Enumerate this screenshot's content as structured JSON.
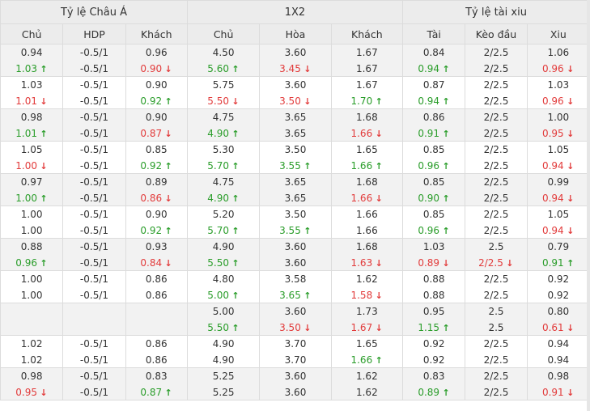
{
  "headers": {
    "groups": [
      "Tỷ lệ Châu Á",
      "1X2",
      "Tỷ lệ tài xiu"
    ],
    "columns": [
      "Chủ",
      "HDP",
      "Khách",
      "Chủ",
      "Hòa",
      "Khách",
      "Tài",
      "Kèo đầu",
      "Xiu"
    ]
  },
  "colors": {
    "up": "#2a9d2a",
    "down": "#e23b3b",
    "header_bg": "#ececec",
    "stripe_bg": "#f2f2f2"
  },
  "icons": {
    "up": "arrow-up-icon",
    "down": "arrow-down-icon"
  },
  "rows": [
    [
      [
        {
          "v": "0.94",
          "d": "same"
        },
        {
          "v": "1.03",
          "d": "up"
        }
      ],
      [
        {
          "v": "-0.5/1",
          "d": "same"
        },
        {
          "v": "-0.5/1",
          "d": "same"
        }
      ],
      [
        {
          "v": "0.96",
          "d": "same"
        },
        {
          "v": "0.90",
          "d": "down"
        }
      ],
      [
        {
          "v": "4.50",
          "d": "same"
        },
        {
          "v": "5.60",
          "d": "up"
        }
      ],
      [
        {
          "v": "3.60",
          "d": "same"
        },
        {
          "v": "3.45",
          "d": "down"
        }
      ],
      [
        {
          "v": "1.67",
          "d": "same"
        },
        {
          "v": "1.67",
          "d": "same"
        }
      ],
      [
        {
          "v": "0.84",
          "d": "same"
        },
        {
          "v": "0.94",
          "d": "up"
        }
      ],
      [
        {
          "v": "2/2.5",
          "d": "same"
        },
        {
          "v": "2/2.5",
          "d": "same"
        }
      ],
      [
        {
          "v": "1.06",
          "d": "same"
        },
        {
          "v": "0.96",
          "d": "down"
        }
      ]
    ],
    [
      [
        {
          "v": "1.03",
          "d": "same"
        },
        {
          "v": "1.01",
          "d": "down"
        }
      ],
      [
        {
          "v": "-0.5/1",
          "d": "same"
        },
        {
          "v": "-0.5/1",
          "d": "same"
        }
      ],
      [
        {
          "v": "0.90",
          "d": "same"
        },
        {
          "v": "0.92",
          "d": "up"
        }
      ],
      [
        {
          "v": "5.75",
          "d": "same"
        },
        {
          "v": "5.50",
          "d": "down"
        }
      ],
      [
        {
          "v": "3.60",
          "d": "same"
        },
        {
          "v": "3.50",
          "d": "down"
        }
      ],
      [
        {
          "v": "1.67",
          "d": "same"
        },
        {
          "v": "1.70",
          "d": "up"
        }
      ],
      [
        {
          "v": "0.87",
          "d": "same"
        },
        {
          "v": "0.94",
          "d": "up"
        }
      ],
      [
        {
          "v": "2/2.5",
          "d": "same"
        },
        {
          "v": "2/2.5",
          "d": "same"
        }
      ],
      [
        {
          "v": "1.03",
          "d": "same"
        },
        {
          "v": "0.96",
          "d": "down"
        }
      ]
    ],
    [
      [
        {
          "v": "0.98",
          "d": "same"
        },
        {
          "v": "1.01",
          "d": "up"
        }
      ],
      [
        {
          "v": "-0.5/1",
          "d": "same"
        },
        {
          "v": "-0.5/1",
          "d": "same"
        }
      ],
      [
        {
          "v": "0.90",
          "d": "same"
        },
        {
          "v": "0.87",
          "d": "down"
        }
      ],
      [
        {
          "v": "4.75",
          "d": "same"
        },
        {
          "v": "4.90",
          "d": "up"
        }
      ],
      [
        {
          "v": "3.65",
          "d": "same"
        },
        {
          "v": "3.65",
          "d": "same"
        }
      ],
      [
        {
          "v": "1.68",
          "d": "same"
        },
        {
          "v": "1.66",
          "d": "down"
        }
      ],
      [
        {
          "v": "0.86",
          "d": "same"
        },
        {
          "v": "0.91",
          "d": "up"
        }
      ],
      [
        {
          "v": "2/2.5",
          "d": "same"
        },
        {
          "v": "2/2.5",
          "d": "same"
        }
      ],
      [
        {
          "v": "1.00",
          "d": "same"
        },
        {
          "v": "0.95",
          "d": "down"
        }
      ]
    ],
    [
      [
        {
          "v": "1.05",
          "d": "same"
        },
        {
          "v": "1.00",
          "d": "down"
        }
      ],
      [
        {
          "v": "-0.5/1",
          "d": "same"
        },
        {
          "v": "-0.5/1",
          "d": "same"
        }
      ],
      [
        {
          "v": "0.85",
          "d": "same"
        },
        {
          "v": "0.92",
          "d": "up"
        }
      ],
      [
        {
          "v": "5.30",
          "d": "same"
        },
        {
          "v": "5.70",
          "d": "up"
        }
      ],
      [
        {
          "v": "3.50",
          "d": "same"
        },
        {
          "v": "3.55",
          "d": "up"
        }
      ],
      [
        {
          "v": "1.65",
          "d": "same"
        },
        {
          "v": "1.66",
          "d": "up"
        }
      ],
      [
        {
          "v": "0.85",
          "d": "same"
        },
        {
          "v": "0.96",
          "d": "up"
        }
      ],
      [
        {
          "v": "2/2.5",
          "d": "same"
        },
        {
          "v": "2/2.5",
          "d": "same"
        }
      ],
      [
        {
          "v": "1.05",
          "d": "same"
        },
        {
          "v": "0.94",
          "d": "down"
        }
      ]
    ],
    [
      [
        {
          "v": "0.97",
          "d": "same"
        },
        {
          "v": "1.00",
          "d": "up"
        }
      ],
      [
        {
          "v": "-0.5/1",
          "d": "same"
        },
        {
          "v": "-0.5/1",
          "d": "same"
        }
      ],
      [
        {
          "v": "0.89",
          "d": "same"
        },
        {
          "v": "0.86",
          "d": "down"
        }
      ],
      [
        {
          "v": "4.75",
          "d": "same"
        },
        {
          "v": "4.90",
          "d": "up"
        }
      ],
      [
        {
          "v": "3.65",
          "d": "same"
        },
        {
          "v": "3.65",
          "d": "same"
        }
      ],
      [
        {
          "v": "1.68",
          "d": "same"
        },
        {
          "v": "1.66",
          "d": "down"
        }
      ],
      [
        {
          "v": "0.85",
          "d": "same"
        },
        {
          "v": "0.90",
          "d": "up"
        }
      ],
      [
        {
          "v": "2/2.5",
          "d": "same"
        },
        {
          "v": "2/2.5",
          "d": "same"
        }
      ],
      [
        {
          "v": "0.99",
          "d": "same"
        },
        {
          "v": "0.94",
          "d": "down"
        }
      ]
    ],
    [
      [
        {
          "v": "1.00",
          "d": "same"
        },
        {
          "v": "1.00",
          "d": "same"
        }
      ],
      [
        {
          "v": "-0.5/1",
          "d": "same"
        },
        {
          "v": "-0.5/1",
          "d": "same"
        }
      ],
      [
        {
          "v": "0.90",
          "d": "same"
        },
        {
          "v": "0.92",
          "d": "up"
        }
      ],
      [
        {
          "v": "5.20",
          "d": "same"
        },
        {
          "v": "5.70",
          "d": "up"
        }
      ],
      [
        {
          "v": "3.50",
          "d": "same"
        },
        {
          "v": "3.55",
          "d": "up"
        }
      ],
      [
        {
          "v": "1.66",
          "d": "same"
        },
        {
          "v": "1.66",
          "d": "same"
        }
      ],
      [
        {
          "v": "0.85",
          "d": "same"
        },
        {
          "v": "0.96",
          "d": "up"
        }
      ],
      [
        {
          "v": "2/2.5",
          "d": "same"
        },
        {
          "v": "2/2.5",
          "d": "same"
        }
      ],
      [
        {
          "v": "1.05",
          "d": "same"
        },
        {
          "v": "0.94",
          "d": "down"
        }
      ]
    ],
    [
      [
        {
          "v": "0.88",
          "d": "same"
        },
        {
          "v": "0.96",
          "d": "up"
        }
      ],
      [
        {
          "v": "-0.5/1",
          "d": "same"
        },
        {
          "v": "-0.5/1",
          "d": "same"
        }
      ],
      [
        {
          "v": "0.93",
          "d": "same"
        },
        {
          "v": "0.84",
          "d": "down"
        }
      ],
      [
        {
          "v": "4.90",
          "d": "same"
        },
        {
          "v": "5.50",
          "d": "up"
        }
      ],
      [
        {
          "v": "3.60",
          "d": "same"
        },
        {
          "v": "3.60",
          "d": "same"
        }
      ],
      [
        {
          "v": "1.68",
          "d": "same"
        },
        {
          "v": "1.63",
          "d": "down"
        }
      ],
      [
        {
          "v": "1.03",
          "d": "same"
        },
        {
          "v": "0.89",
          "d": "down"
        }
      ],
      [
        {
          "v": "2.5",
          "d": "same"
        },
        {
          "v": "2/2.5",
          "d": "down"
        }
      ],
      [
        {
          "v": "0.79",
          "d": "same"
        },
        {
          "v": "0.91",
          "d": "up"
        }
      ]
    ],
    [
      [
        {
          "v": "1.00",
          "d": "same"
        },
        {
          "v": "1.00",
          "d": "same"
        }
      ],
      [
        {
          "v": "-0.5/1",
          "d": "same"
        },
        {
          "v": "-0.5/1",
          "d": "same"
        }
      ],
      [
        {
          "v": "0.86",
          "d": "same"
        },
        {
          "v": "0.86",
          "d": "same"
        }
      ],
      [
        {
          "v": "4.80",
          "d": "same"
        },
        {
          "v": "5.00",
          "d": "up"
        }
      ],
      [
        {
          "v": "3.58",
          "d": "same"
        },
        {
          "v": "3.65",
          "d": "up"
        }
      ],
      [
        {
          "v": "1.62",
          "d": "same"
        },
        {
          "v": "1.58",
          "d": "down"
        }
      ],
      [
        {
          "v": "0.88",
          "d": "same"
        },
        {
          "v": "0.88",
          "d": "same"
        }
      ],
      [
        {
          "v": "2/2.5",
          "d": "same"
        },
        {
          "v": "2/2.5",
          "d": "same"
        }
      ],
      [
        {
          "v": "0.92",
          "d": "same"
        },
        {
          "v": "0.92",
          "d": "same"
        }
      ]
    ],
    [
      [],
      [],
      [],
      [
        {
          "v": "5.00",
          "d": "same"
        },
        {
          "v": "5.50",
          "d": "up"
        }
      ],
      [
        {
          "v": "3.60",
          "d": "same"
        },
        {
          "v": "3.50",
          "d": "down"
        }
      ],
      [
        {
          "v": "1.73",
          "d": "same"
        },
        {
          "v": "1.67",
          "d": "down"
        }
      ],
      [
        {
          "v": "0.95",
          "d": "same"
        },
        {
          "v": "1.15",
          "d": "up"
        }
      ],
      [
        {
          "v": "2.5",
          "d": "same"
        },
        {
          "v": "2.5",
          "d": "same"
        }
      ],
      [
        {
          "v": "0.80",
          "d": "same"
        },
        {
          "v": "0.61",
          "d": "down"
        }
      ]
    ],
    [
      [
        {
          "v": "1.02",
          "d": "same"
        },
        {
          "v": "1.02",
          "d": "same"
        }
      ],
      [
        {
          "v": "-0.5/1",
          "d": "same"
        },
        {
          "v": "-0.5/1",
          "d": "same"
        }
      ],
      [
        {
          "v": "0.86",
          "d": "same"
        },
        {
          "v": "0.86",
          "d": "same"
        }
      ],
      [
        {
          "v": "4.90",
          "d": "same"
        },
        {
          "v": "4.90",
          "d": "same"
        }
      ],
      [
        {
          "v": "3.70",
          "d": "same"
        },
        {
          "v": "3.70",
          "d": "same"
        }
      ],
      [
        {
          "v": "1.65",
          "d": "same"
        },
        {
          "v": "1.66",
          "d": "up"
        }
      ],
      [
        {
          "v": "0.92",
          "d": "same"
        },
        {
          "v": "0.92",
          "d": "same"
        }
      ],
      [
        {
          "v": "2/2.5",
          "d": "same"
        },
        {
          "v": "2/2.5",
          "d": "same"
        }
      ],
      [
        {
          "v": "0.94",
          "d": "same"
        },
        {
          "v": "0.94",
          "d": "same"
        }
      ]
    ],
    [
      [
        {
          "v": "0.98",
          "d": "same"
        },
        {
          "v": "0.95",
          "d": "down"
        }
      ],
      [
        {
          "v": "-0.5/1",
          "d": "same"
        },
        {
          "v": "-0.5/1",
          "d": "same"
        }
      ],
      [
        {
          "v": "0.83",
          "d": "same"
        },
        {
          "v": "0.87",
          "d": "up"
        }
      ],
      [
        {
          "v": "5.25",
          "d": "same"
        },
        {
          "v": "5.25",
          "d": "same"
        }
      ],
      [
        {
          "v": "3.60",
          "d": "same"
        },
        {
          "v": "3.60",
          "d": "same"
        }
      ],
      [
        {
          "v": "1.62",
          "d": "same"
        },
        {
          "v": "1.62",
          "d": "same"
        }
      ],
      [
        {
          "v": "0.83",
          "d": "same"
        },
        {
          "v": "0.89",
          "d": "up"
        }
      ],
      [
        {
          "v": "2/2.5",
          "d": "same"
        },
        {
          "v": "2/2.5",
          "d": "same"
        }
      ],
      [
        {
          "v": "0.98",
          "d": "same"
        },
        {
          "v": "0.91",
          "d": "down"
        }
      ]
    ]
  ]
}
